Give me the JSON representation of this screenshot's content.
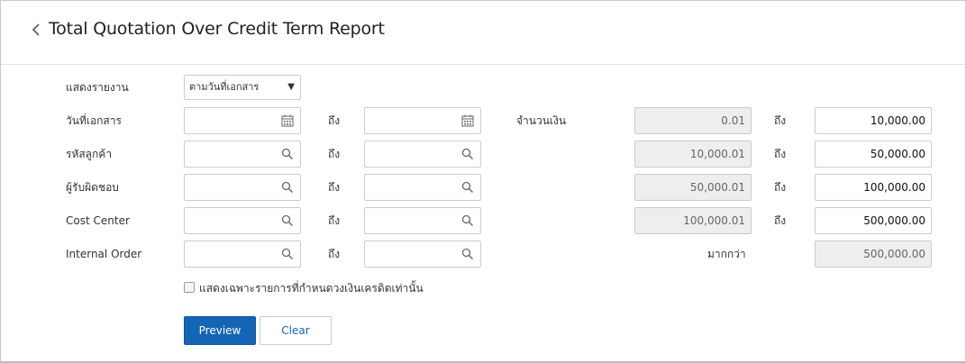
{
  "header": {
    "title": "Total Quotation Over Credit Term Report"
  },
  "form": {
    "report_by": {
      "label": "แสดงรายงาน",
      "value": "ตามวันที่เอกสาร"
    },
    "to_label": "ถึง",
    "rows": [
      {
        "label": "วันที่เอกสาร",
        "icon": "calendar-icon"
      },
      {
        "label": "รหัสลูกค้า",
        "icon": "search-icon"
      },
      {
        "label": "ผู้รับผิดชอบ",
        "icon": "search-icon"
      },
      {
        "label": "Cost Center",
        "icon": "search-icon"
      },
      {
        "label": "Internal Order",
        "icon": "search-icon"
      }
    ],
    "amount": {
      "label": "จำนวนเงิน",
      "ranges": [
        {
          "from": "0.01",
          "to": "10,000.00"
        },
        {
          "from": "10,000.01",
          "to": "50,000.00"
        },
        {
          "from": "50,000.01",
          "to": "100,000.00"
        },
        {
          "from": "100,000.01",
          "to": "500,000.00"
        }
      ],
      "more_than_label": "มากกว่า",
      "more_than_value": "500,000.00"
    },
    "checkbox_label": "แสดงเฉพาะรายการที่กำหนดวงเงินเครดิตเท่านั้น",
    "checkbox_checked": false
  },
  "buttons": {
    "preview": "Preview",
    "clear": "Clear"
  },
  "colors": {
    "primary": "#1565b5",
    "readonly_bg": "#eeeeee"
  }
}
